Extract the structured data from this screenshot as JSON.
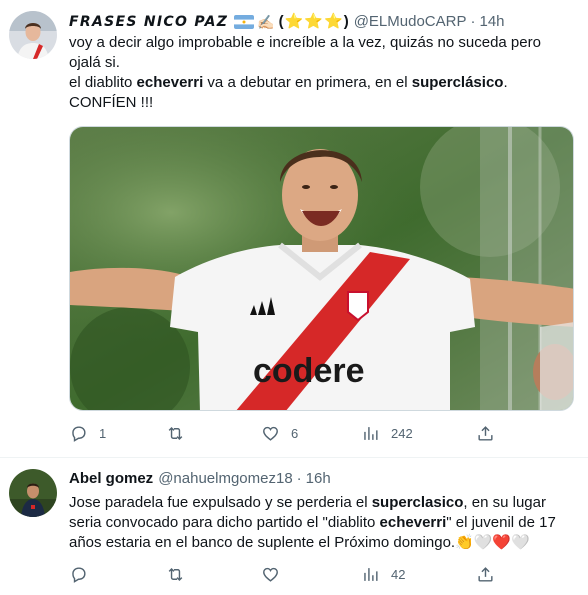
{
  "tweets": [
    {
      "display_name": "FRASES NICO PAZ",
      "name_badge": "(⭐⭐⭐)",
      "handle": "@ELMudoCARP",
      "time": "14h",
      "text": {
        "l1": "voy a decir algo improbable e increíble a la vez, quizás no suceda pero",
        "l2": "ojalá si.",
        "l3a": "el diablito ",
        "l3b": "echeverri",
        "l3c": " va a debutar en primera, en el ",
        "l3d": "superclásico",
        "l3e": ".",
        "l4": "CONFÍEN !!!"
      },
      "media": {
        "sponsor": "codere"
      },
      "stats": {
        "replies": "1",
        "retweets": "",
        "likes": "6",
        "views": "242"
      }
    },
    {
      "display_name": "Abel gomez",
      "handle": "@nahuelmgomez18",
      "time": "16h",
      "text": {
        "l1a": "Jose paradela fue expulsado y se perderia el ",
        "l1b": "superclasico",
        "l1c": ", en su lugar",
        "l2a": "seria convocado para dicho partido el \"diablito ",
        "l2b": "echeverri",
        "l2c": "\" el juvenil de 17",
        "l3": "años estaria en el banco de suplente el Próximo domingo.",
        "l3_emoji": "👏🤍❤️🤍"
      },
      "stats": {
        "replies": "",
        "retweets": "",
        "likes": "",
        "views": "42"
      }
    }
  ],
  "colors": {
    "text": "#0f1419",
    "secondary": "#536471",
    "divider": "#eff3f4",
    "river_red": "#d62828",
    "grass_green": "#3f6b2e"
  },
  "icons": [
    "reply-icon",
    "retweet-icon",
    "like-icon",
    "views-icon",
    "share-icon"
  ]
}
